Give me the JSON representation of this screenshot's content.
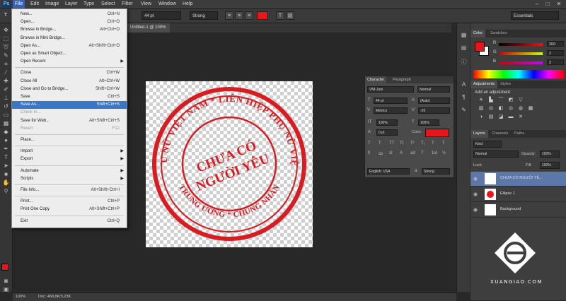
{
  "app": {
    "logo": "Ps",
    "window_controls": [
      "–",
      "□",
      "✕"
    ]
  },
  "menubar": [
    "File",
    "Edit",
    "Image",
    "Layer",
    "Type",
    "Select",
    "Filter",
    "View",
    "Window",
    "Help"
  ],
  "options_bar": {
    "tool_glyph": "T",
    "font_size": "44 pt",
    "antialias": "Strong",
    "text_color": "#e8151b",
    "workspace": "Essentials"
  },
  "document": {
    "tab_label": "Untitled-1 @ 100%",
    "stamp_color": "#d81c22",
    "stamp_outer_text": "HỘI PHỤ NỮ VIỆT NAM * LIÊN HIỆP PHỤ NỮ VIỆT NAM",
    "stamp_bottom_text": "TRUNG ƯƠNG * CHUNG NHÂN",
    "stamp_center_line1": "CHƯA CÓ",
    "stamp_center_line2": "NGƯỜI YÊU"
  },
  "file_menu": {
    "items": [
      {
        "label": "New...",
        "shortcut": "Ctrl+N"
      },
      {
        "label": "Open...",
        "shortcut": "Ctrl+O"
      },
      {
        "label": "Browse in Bridge...",
        "shortcut": "Alt+Ctrl+O"
      },
      {
        "label": "Browse in Mini Bridge...",
        "shortcut": ""
      },
      {
        "label": "Open As...",
        "shortcut": "Alt+Shift+Ctrl+O"
      },
      {
        "label": "Open as Smart Object...",
        "shortcut": ""
      },
      {
        "label": "Open Recent",
        "shortcut": "",
        "submenu": true
      },
      {
        "label": "Close",
        "shortcut": "Ctrl+W"
      },
      {
        "label": "Close All",
        "shortcut": "Alt+Ctrl+W"
      },
      {
        "label": "Close and Go to Bridge...",
        "shortcut": "Shift+Ctrl+W"
      },
      {
        "label": "Save",
        "shortcut": "Ctrl+S"
      },
      {
        "label": "Save As...",
        "shortcut": "Shift+Ctrl+S",
        "selected": true
      },
      {
        "label": "Check In...",
        "shortcut": "",
        "disabled": true
      },
      {
        "label": "Save for Web...",
        "shortcut": "Alt+Shift+Ctrl+S"
      },
      {
        "label": "Revert",
        "shortcut": "F12",
        "disabled": true
      },
      {
        "label": "Place...",
        "shortcut": ""
      },
      {
        "label": "Import",
        "shortcut": "",
        "submenu": true
      },
      {
        "label": "Export",
        "shortcut": "",
        "submenu": true
      },
      {
        "label": "Automate",
        "shortcut": "",
        "submenu": true
      },
      {
        "label": "Scripts",
        "shortcut": "",
        "submenu": true
      },
      {
        "label": "File Info...",
        "shortcut": "Alt+Shift+Ctrl+I"
      },
      {
        "label": "Print...",
        "shortcut": "Ctrl+P"
      },
      {
        "label": "Print One Copy",
        "shortcut": "Alt+Shift+Ctrl+P"
      },
      {
        "label": "Exit",
        "shortcut": "Ctrl+Q"
      }
    ]
  },
  "character_panel": {
    "tabs": [
      "Character",
      "Paragraph"
    ],
    "font_family": "VNI-Juni",
    "font_style": "Normal",
    "font_size": "44 pt",
    "leading": "(Auto)",
    "kerning": "Metrics",
    "tracking": "-20",
    "vertical_scale": "100%",
    "horizontal_scale": "100%",
    "baseline_shift": "0 pt",
    "color_label": "Color:",
    "color": "#e8151b",
    "language": "English: USA",
    "aa_label": "a",
    "antialias": "Strong",
    "style_buttons": [
      "T",
      "T",
      "TT",
      "Tt",
      "T¹",
      "T₁",
      "T",
      "T"
    ],
    "extra_buttons": [
      "fi",
      "ꝏ",
      "st",
      "A",
      "ad",
      "T",
      "1st",
      "½"
    ]
  },
  "color_panel": {
    "tabs": [
      "Color",
      "Swatches"
    ],
    "foreground": "#e8151b",
    "R_label": "R",
    "G_label": "G",
    "B_label": "B",
    "R": "200",
    "G": "2",
    "B": "2"
  },
  "adjustments_panel": {
    "tabs": [
      "Adjustments",
      "Styles"
    ],
    "title": "Add an adjustment"
  },
  "layers_panel": {
    "tabs": [
      "Layers",
      "Channels",
      "Paths"
    ],
    "kind": "Kind",
    "blend_mode": "Normal",
    "opacity_label": "Opacity:",
    "opacity": "100%",
    "lock_label": "Lock:",
    "fill_label": "Fill:",
    "fill": "100%",
    "layers": [
      {
        "name": "CHƯA CÓ NGƯỜI YÊ...",
        "selected": true
      },
      {
        "name": "Ellipse 1",
        "selected": false
      },
      {
        "name": "Background",
        "selected": false
      }
    ]
  },
  "watermark": {
    "text": "XUANGIAO.COM"
  },
  "status": {
    "zoom": "100%",
    "doc": "Doc: 468,8K/3,23K"
  }
}
